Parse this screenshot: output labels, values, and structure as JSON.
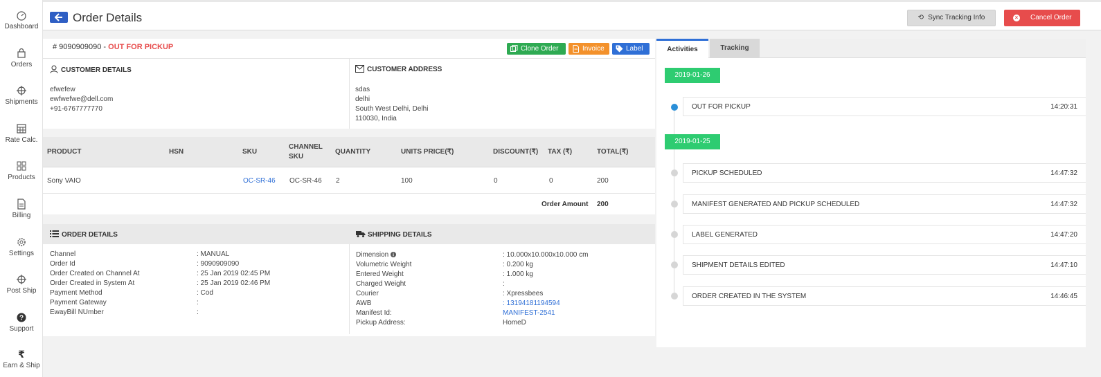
{
  "sidebar": {
    "items": [
      {
        "label": "Dashboard",
        "icon": "dashboard-icon"
      },
      {
        "label": "Orders",
        "icon": "bag-icon"
      },
      {
        "label": "Shipments",
        "icon": "crosshair-icon"
      },
      {
        "label": "Rate Calc.",
        "icon": "calculator-icon"
      },
      {
        "label": "Products",
        "icon": "grid-icon"
      },
      {
        "label": "Billing",
        "icon": "document-icon"
      },
      {
        "label": "Settings",
        "icon": "gear-icon"
      },
      {
        "label": "Post Ship",
        "icon": "crosshair-icon"
      },
      {
        "label": "Support",
        "icon": "help-icon"
      },
      {
        "label": "Earn & Ship",
        "icon": "rupee-icon"
      }
    ]
  },
  "header": {
    "title": "Order Details",
    "sync_label": "Sync Tracking Info",
    "cancel_label": "Cancel Order"
  },
  "order": {
    "id_prefix": "# 9090909090 - ",
    "status": "OUT FOR PICKUP",
    "buttons": {
      "clone": "Clone Order",
      "invoice": "Invoice",
      "label": "Label"
    }
  },
  "customer": {
    "title": "CUSTOMER DETAILS",
    "name": "efwefew",
    "email": "ewfwefwe@dell.com",
    "phone": "+91-6767777770"
  },
  "address": {
    "title": "CUSTOMER ADDRESS",
    "line1": "sdas",
    "line2": "delhi",
    "line3": "South West Delhi, Delhi",
    "line4": "110030, India"
  },
  "products": {
    "headers": {
      "product": "PRODUCT",
      "hsn": "HSN",
      "sku": "SKU",
      "channel_sku_1": "CHANNEL",
      "channel_sku_2": "SKU",
      "quantity": "QUANTITY",
      "unit_price": "UNITS PRICE(₹)",
      "discount": "DISCOUNT(₹)",
      "tax": "TAX (₹)",
      "total": "TOTAL(₹)"
    },
    "row": {
      "product": "Sony VAIO",
      "hsn": "",
      "sku": "OC-SR-46",
      "channel_sku": "OC-SR-46",
      "quantity": "2",
      "unit_price": "100",
      "discount": "0",
      "tax": "0",
      "total": "200"
    },
    "order_amount_label": "Order Amount",
    "order_amount": "200"
  },
  "order_details": {
    "title": "ORDER DETAILS",
    "rows": [
      {
        "k": "Channel",
        "v": ": MANUAL"
      },
      {
        "k": "Order Id",
        "v": ": 9090909090"
      },
      {
        "k": "Order Created on Channel At",
        "v": ": 25 Jan 2019 02:45 PM"
      },
      {
        "k": "Order Created in System At",
        "v": ": 25 Jan 2019 02:46 PM"
      },
      {
        "k": "Payment Method",
        "v": ": Cod"
      },
      {
        "k": "Payment Gateway",
        "v": ":"
      },
      {
        "k": "EwayBill NUmber",
        "v": ":"
      }
    ]
  },
  "shipping_details": {
    "title": "SHIPPING DETAILS",
    "rows": [
      {
        "k": "Dimension",
        "v": ": 10.000x10.000x10.000 cm"
      },
      {
        "k": "Volumetric Weight",
        "v": ":  0.200 kg"
      },
      {
        "k": "Entered Weight",
        "v": ":  1.000 kg"
      },
      {
        "k": "Charged Weight",
        "v": ":"
      },
      {
        "k": "Courier",
        "v": ": Xpressbees"
      },
      {
        "k": "AWB",
        "v": ": 13194181194594"
      },
      {
        "k": "Manifest Id:",
        "v": "MANIFEST-2541"
      },
      {
        "k": "Pickup Address:",
        "v": "HomeD"
      }
    ]
  },
  "tabs": {
    "activities": "Activities",
    "tracking": "Tracking"
  },
  "timeline": {
    "dates": [
      "2019-01-26",
      "2019-01-25"
    ],
    "events": [
      {
        "name": "OUT FOR PICKUP",
        "time": "14:20:31"
      },
      {
        "name": "PICKUP SCHEDULED",
        "time": "14:47:32"
      },
      {
        "name": "MANIFEST GENERATED AND PICKUP SCHEDULED",
        "time": "14:47:32"
      },
      {
        "name": "LABEL GENERATED",
        "time": "14:47:20"
      },
      {
        "name": "SHIPMENT DETAILS EDITED",
        "time": "14:47:10"
      },
      {
        "name": "ORDER CREATED IN THE SYSTEM",
        "time": "14:46:45"
      }
    ]
  },
  "colors": {
    "accent": "#2f6fd6",
    "danger": "#e74c4c",
    "success": "#2ecc71",
    "warning": "#f3912b"
  }
}
